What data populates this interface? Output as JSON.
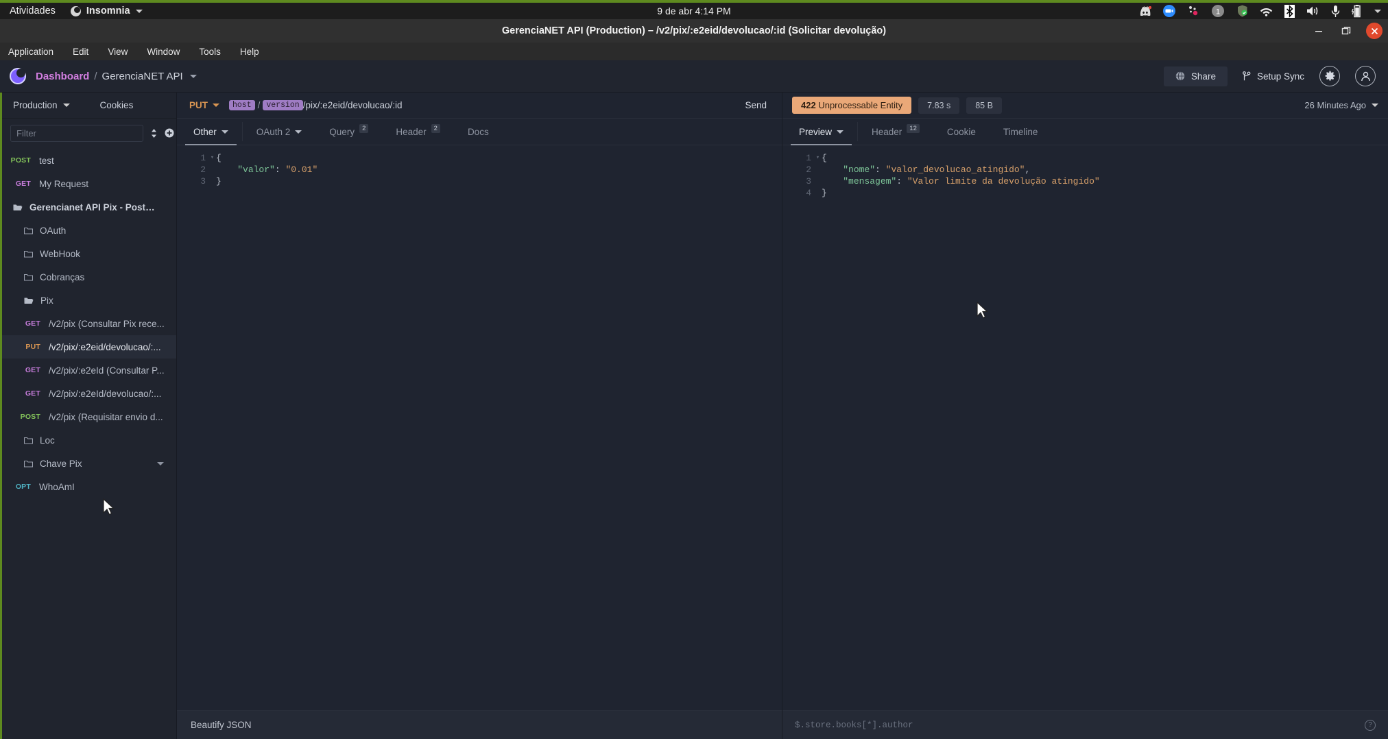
{
  "desktop": {
    "activities": "Atividades",
    "app_name": "Insomnia",
    "clock": "9 de abr  4:14 PM",
    "tray_icons": [
      "discord-icon",
      "zoom-icon",
      "dots-icon",
      "workspace-indicator",
      "shield-icon",
      "wifi-icon",
      "bluetooth-icon",
      "volume-icon",
      "microphone-icon",
      "battery-icon",
      "chevron-down-icon"
    ],
    "workspace_number": "1"
  },
  "window": {
    "title": "GerenciaNET API (Production) – /v2/pix/:e2eid/devolucao/:id (Solicitar devolução)",
    "minimize": "—",
    "maximize": "❐",
    "close": "✕"
  },
  "menubar": {
    "items": [
      "Application",
      "Edit",
      "View",
      "Window",
      "Tools",
      "Help"
    ]
  },
  "header": {
    "dashboard_label": "Dashboard",
    "separator": "/",
    "workspace_label": "GerenciaNET API",
    "share_label": "Share",
    "sync_label": "Setup Sync",
    "settings_icon": "gear-icon",
    "account_icon": "user-avatar-icon"
  },
  "sidebar": {
    "environment": "Production",
    "cookies": "Cookies",
    "filter_placeholder": "Filter",
    "sort_icon": "sort-icon",
    "add_icon": "plus-icon",
    "items": [
      {
        "type": "request",
        "method": "POST",
        "method_class": "m-post",
        "label": "test",
        "indent": 0,
        "selected": false
      },
      {
        "type": "request",
        "method": "GET",
        "method_class": "m-get",
        "label": "My Request",
        "indent": 0,
        "selected": false
      },
      {
        "type": "folder",
        "label": "Gerencianet API Pix - Postman Coll...",
        "level": "root",
        "open": true
      },
      {
        "type": "folder",
        "label": "OAuth",
        "level": "nested",
        "open": false
      },
      {
        "type": "folder",
        "label": "WebHook",
        "level": "nested",
        "open": false
      },
      {
        "type": "folder",
        "label": "Cobranças",
        "level": "nested",
        "open": false
      },
      {
        "type": "folder",
        "label": "Pix",
        "level": "nested",
        "open": true
      },
      {
        "type": "request",
        "method": "GET",
        "method_class": "m-get",
        "label": "/v2/pix (Consultar Pix rece...",
        "indent": 1,
        "selected": false
      },
      {
        "type": "request",
        "method": "PUT",
        "method_class": "m-put",
        "label": "/v2/pix/:e2eid/devolucao/:...",
        "indent": 1,
        "selected": true
      },
      {
        "type": "request",
        "method": "GET",
        "method_class": "m-get",
        "label": "/v2/pix/:e2eId (Consultar P...",
        "indent": 1,
        "selected": false
      },
      {
        "type": "request",
        "method": "GET",
        "method_class": "m-get",
        "label": "/v2/pix/:e2eId/devolucao/:...",
        "indent": 1,
        "selected": false
      },
      {
        "type": "request",
        "method": "POST",
        "method_class": "m-post",
        "label": "/v2/pix (Requisitar envio d...",
        "indent": 1,
        "selected": false
      },
      {
        "type": "folder",
        "label": "Loc",
        "level": "nested",
        "open": false
      },
      {
        "type": "folder",
        "label": "Chave Pix",
        "level": "nested",
        "open": false,
        "has_caret": true
      },
      {
        "type": "request",
        "method": "OPT",
        "method_class": "m-opt",
        "label": "WhoAmI",
        "indent": 0,
        "selected": false
      }
    ]
  },
  "request": {
    "method": "PUT",
    "url_var_host": "host",
    "url_var_version": "version",
    "url_path": "/pix/:e2eid/devolucao/:id",
    "send_label": "Send",
    "tabs": [
      {
        "label": "Other",
        "active": true,
        "dropdown": true,
        "badge": ""
      },
      {
        "label": "OAuth 2",
        "active": false,
        "dropdown": true,
        "badge": ""
      },
      {
        "label": "Query",
        "active": false,
        "dropdown": false,
        "badge": "2"
      },
      {
        "label": "Header",
        "active": false,
        "dropdown": false,
        "badge": "2"
      },
      {
        "label": "Docs",
        "active": false,
        "dropdown": false,
        "badge": ""
      }
    ],
    "body_lines": [
      {
        "num": "1",
        "fold": "▾",
        "segments": [
          {
            "t": "{",
            "c": "c-punct"
          }
        ]
      },
      {
        "num": "2",
        "fold": "",
        "segments": [
          {
            "t": "    ",
            "c": "c-punct"
          },
          {
            "t": "\"valor\"",
            "c": "c-key"
          },
          {
            "t": ": ",
            "c": "c-punct"
          },
          {
            "t": "\"0.01\"",
            "c": "c-str"
          }
        ]
      },
      {
        "num": "3",
        "fold": "",
        "segments": [
          {
            "t": "}",
            "c": "c-punct"
          }
        ]
      }
    ],
    "footer_label": "Beautify JSON"
  },
  "response": {
    "status_code": "422",
    "status_text": "Unprocessable Entity",
    "time": "7.83 s",
    "size": "85 B",
    "timestamp": "26 Minutes Ago",
    "tabs": [
      {
        "label": "Preview",
        "active": true,
        "dropdown": true,
        "badge": ""
      },
      {
        "label": "Header",
        "active": false,
        "dropdown": false,
        "badge": "12"
      },
      {
        "label": "Cookie",
        "active": false,
        "dropdown": false,
        "badge": ""
      },
      {
        "label": "Timeline",
        "active": false,
        "dropdown": false,
        "badge": ""
      }
    ],
    "body_lines": [
      {
        "num": "1",
        "fold": "▾",
        "segments": [
          {
            "t": "{",
            "c": "c-punct"
          }
        ]
      },
      {
        "num": "2",
        "fold": "",
        "segments": [
          {
            "t": "    ",
            "c": "c-punct"
          },
          {
            "t": "\"nome\"",
            "c": "c-key"
          },
          {
            "t": ": ",
            "c": "c-punct"
          },
          {
            "t": "\"valor_devolucao_atingido\"",
            "c": "c-str"
          },
          {
            "t": ",",
            "c": "c-punct"
          }
        ]
      },
      {
        "num": "3",
        "fold": "",
        "segments": [
          {
            "t": "    ",
            "c": "c-punct"
          },
          {
            "t": "\"mensagem\"",
            "c": "c-key"
          },
          {
            "t": ": ",
            "c": "c-punct"
          },
          {
            "t": "\"Valor limite da devolução atingido\"",
            "c": "c-str"
          }
        ]
      },
      {
        "num": "4",
        "fold": "",
        "segments": [
          {
            "t": "}",
            "c": "c-punct"
          }
        ]
      }
    ],
    "filter_placeholder": "$.store.books[*].author",
    "help_icon": "help-icon"
  },
  "colors": {
    "accent_purple": "#7d5fff",
    "status_422": "#eaa878",
    "method_put": "#d89552",
    "method_get": "#c77ddb",
    "method_post": "#83c25a",
    "method_opt": "#4fb3c4",
    "ubuntu_green": "#5e8a1f"
  }
}
